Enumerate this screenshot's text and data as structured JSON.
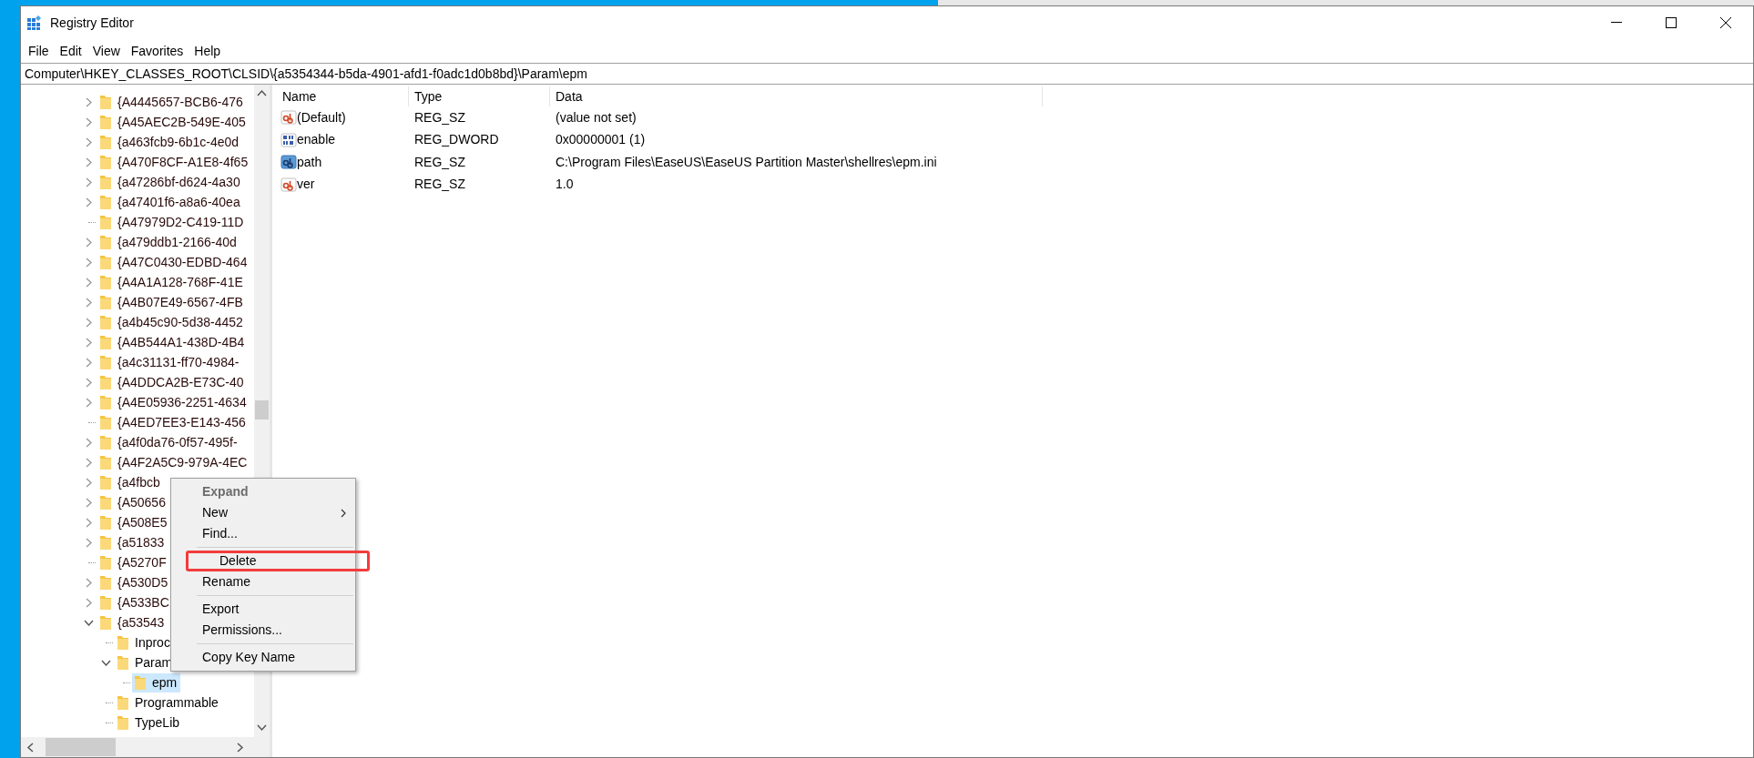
{
  "window": {
    "title": "Registry Editor"
  },
  "menu_bar": [
    "File",
    "Edit",
    "View",
    "Favorites",
    "Help"
  ],
  "address": "Computer\\HKEY_CLASSES_ROOT\\CLSID\\{a5354344-b5da-4901-afd1-f0adc1d0b8bd}\\Param\\epm",
  "tree": [
    {
      "label": "{A4445657-BCB6-476",
      "expandable": true,
      "expanded": false,
      "selected": false
    },
    {
      "label": "{A45AEC2B-549E-405",
      "expandable": true,
      "expanded": false,
      "selected": false
    },
    {
      "label": "{a463fcb9-6b1c-4e0d",
      "expandable": true,
      "expanded": false,
      "selected": false
    },
    {
      "label": "{A470F8CF-A1E8-4f65",
      "expandable": true,
      "expanded": false,
      "selected": false
    },
    {
      "label": "{a47286bf-d624-4a30",
      "expandable": true,
      "expanded": false,
      "selected": false
    },
    {
      "label": "{a47401f6-a8a6-40ea",
      "expandable": true,
      "expanded": false,
      "selected": false
    },
    {
      "label": "{A47979D2-C419-11D",
      "expandable": false,
      "selected": false
    },
    {
      "label": "{a479ddb1-2166-40d",
      "expandable": true,
      "expanded": false,
      "selected": false
    },
    {
      "label": "{A47C0430-EDBD-464",
      "expandable": true,
      "expanded": false,
      "selected": false
    },
    {
      "label": "{A4A1A128-768F-41E",
      "expandable": true,
      "expanded": false,
      "selected": false
    },
    {
      "label": "{A4B07E49-6567-4FB",
      "expandable": true,
      "expanded": false,
      "selected": false
    },
    {
      "label": "{a4b45c90-5d38-4452",
      "expandable": true,
      "expanded": false,
      "selected": false
    },
    {
      "label": "{A4B544A1-438D-4B4",
      "expandable": true,
      "expanded": false,
      "selected": false
    },
    {
      "label": "{a4c31131-ff70-4984-",
      "expandable": true,
      "expanded": false,
      "selected": false
    },
    {
      "label": "{A4DDCA2B-E73C-40",
      "expandable": true,
      "expanded": false,
      "selected": false
    },
    {
      "label": "{A4E05936-2251-4634",
      "expandable": true,
      "expanded": false,
      "selected": false
    },
    {
      "label": "{A4ED7EE3-E143-456",
      "expandable": false,
      "selected": false
    },
    {
      "label": "{a4f0da76-0f57-495f-",
      "expandable": true,
      "expanded": false,
      "selected": false
    },
    {
      "label": "{A4F2A5C9-979A-4EC",
      "expandable": true,
      "expanded": false,
      "selected": false
    },
    {
      "label": "{a4fbcb",
      "expandable": true,
      "expanded": false,
      "selected": false
    },
    {
      "label": "{A50656",
      "expandable": true,
      "expanded": false,
      "selected": false
    },
    {
      "label": "{A508E5",
      "expandable": true,
      "expanded": false,
      "selected": false
    },
    {
      "label": "{a51833",
      "expandable": true,
      "expanded": false,
      "selected": false
    },
    {
      "label": "{A5270F",
      "expandable": false,
      "selected": false
    },
    {
      "label": "{A530D5",
      "expandable": true,
      "expanded": false,
      "selected": false
    },
    {
      "label": "{A533BC",
      "expandable": true,
      "expanded": false,
      "selected": false
    },
    {
      "label": "{a53543",
      "expandable": true,
      "expanded": true,
      "selected": false,
      "children": [
        {
          "label": "Inproc",
          "expandable": false,
          "selected": false
        },
        {
          "label": "Param",
          "expandable": true,
          "expanded": true,
          "selected": false,
          "children": [
            {
              "label": "epm",
              "expandable": false,
              "selected": true
            }
          ]
        },
        {
          "label": "Programmable",
          "expandable": false,
          "selected": false
        },
        {
          "label": "TypeLib",
          "expandable": false,
          "selected": false
        }
      ]
    }
  ],
  "table": {
    "columns": [
      "Name",
      "Type",
      "Data"
    ],
    "rows": [
      {
        "kind": "string",
        "name": "(Default)",
        "type": "REG_SZ",
        "data": "(value not set)"
      },
      {
        "kind": "binary",
        "name": "enable",
        "type": "REG_DWORD",
        "data": "0x00000001 (1)"
      },
      {
        "kind": "expandstring",
        "name": "path",
        "type": "REG_SZ",
        "data": "C:\\Program Files\\EaseUS\\EaseUS Partition Master\\shellres\\epm.ini"
      },
      {
        "kind": "string",
        "name": "ver",
        "type": "REG_SZ",
        "data": "1.0"
      }
    ]
  },
  "context_menu": [
    {
      "kind": "item",
      "label": "Expand",
      "bold": true,
      "disabled": true,
      "submenu": false,
      "annotated": false
    },
    {
      "kind": "item",
      "label": "New",
      "bold": false,
      "disabled": false,
      "submenu": true,
      "annotated": false
    },
    {
      "kind": "item",
      "label": "Find...",
      "bold": false,
      "disabled": false,
      "submenu": false,
      "annotated": false
    },
    {
      "kind": "separator"
    },
    {
      "kind": "item",
      "label": "Delete",
      "bold": false,
      "disabled": false,
      "submenu": false,
      "annotated": true
    },
    {
      "kind": "item",
      "label": "Rename",
      "bold": false,
      "disabled": false,
      "submenu": false,
      "annotated": false
    },
    {
      "kind": "separator"
    },
    {
      "kind": "item",
      "label": "Export",
      "bold": false,
      "disabled": false,
      "submenu": false,
      "annotated": false
    },
    {
      "kind": "item",
      "label": "Permissions...",
      "bold": false,
      "disabled": false,
      "submenu": false,
      "annotated": false
    },
    {
      "kind": "separator"
    },
    {
      "kind": "item",
      "label": "Copy Key Name",
      "bold": false,
      "disabled": false,
      "submenu": false,
      "annotated": false
    }
  ]
}
